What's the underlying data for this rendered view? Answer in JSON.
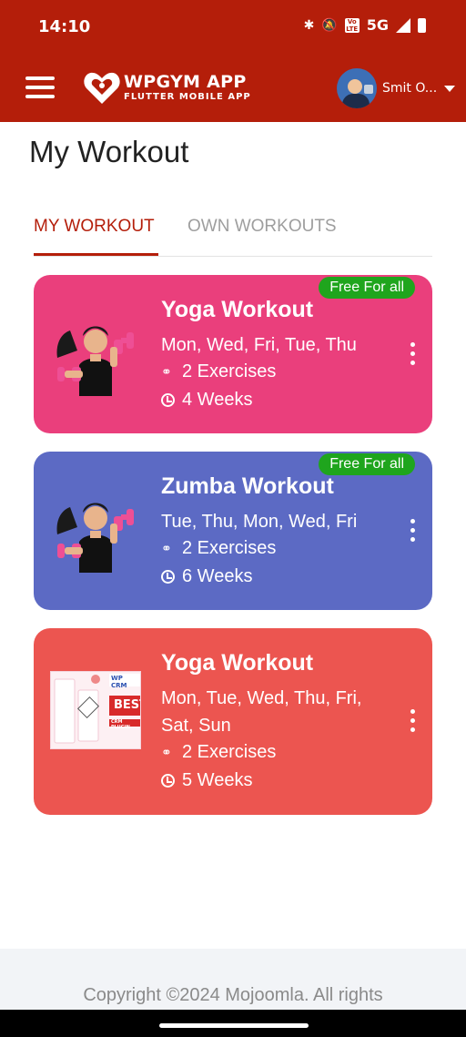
{
  "status_bar": {
    "time": "14:10",
    "network": "5G",
    "lte_label": "Vo LTE"
  },
  "app_bar": {
    "logo_title": "WPGYM APP",
    "logo_subtitle": "FLUTTER MOBILE APP",
    "user_name": "Smit O...",
    "background_color": "#b41e0a"
  },
  "page": {
    "title": "My Workout"
  },
  "tabs": [
    {
      "label": "MY WORKOUT",
      "active": true
    },
    {
      "label": "OWN WORKOUTS",
      "active": false
    }
  ],
  "workouts": [
    {
      "badge": "Free For all",
      "title": "Yoga Workout",
      "days": "Mon, Wed, Fri, Tue, Thu",
      "exercises": "2 Exercises",
      "duration": "4 Weeks",
      "color": "#ea3f7c",
      "image": "woman-dumbbells"
    },
    {
      "badge": "Free For all",
      "title": "Zumba Workout",
      "days": "Tue, Thu, Mon, Wed, Fri",
      "exercises": "2 Exercises",
      "duration": "6 Weeks",
      "color": "#5c6ac4",
      "image": "woman-dumbbells"
    },
    {
      "title": "Yoga Workout",
      "days": "Mon, Tue, Wed, Thu, Fri, Sat, Sun",
      "exercises": "2 Exercises",
      "duration": "5 Weeks",
      "color": "#ec5550",
      "image": "wp-crm-banner",
      "image_text": {
        "brand": "WP CRM",
        "tagline": "BEST",
        "sub": "CRM PLUGIN"
      }
    }
  ],
  "footer": {
    "text": "Copyright ©2024 Mojoomla. All rights"
  }
}
